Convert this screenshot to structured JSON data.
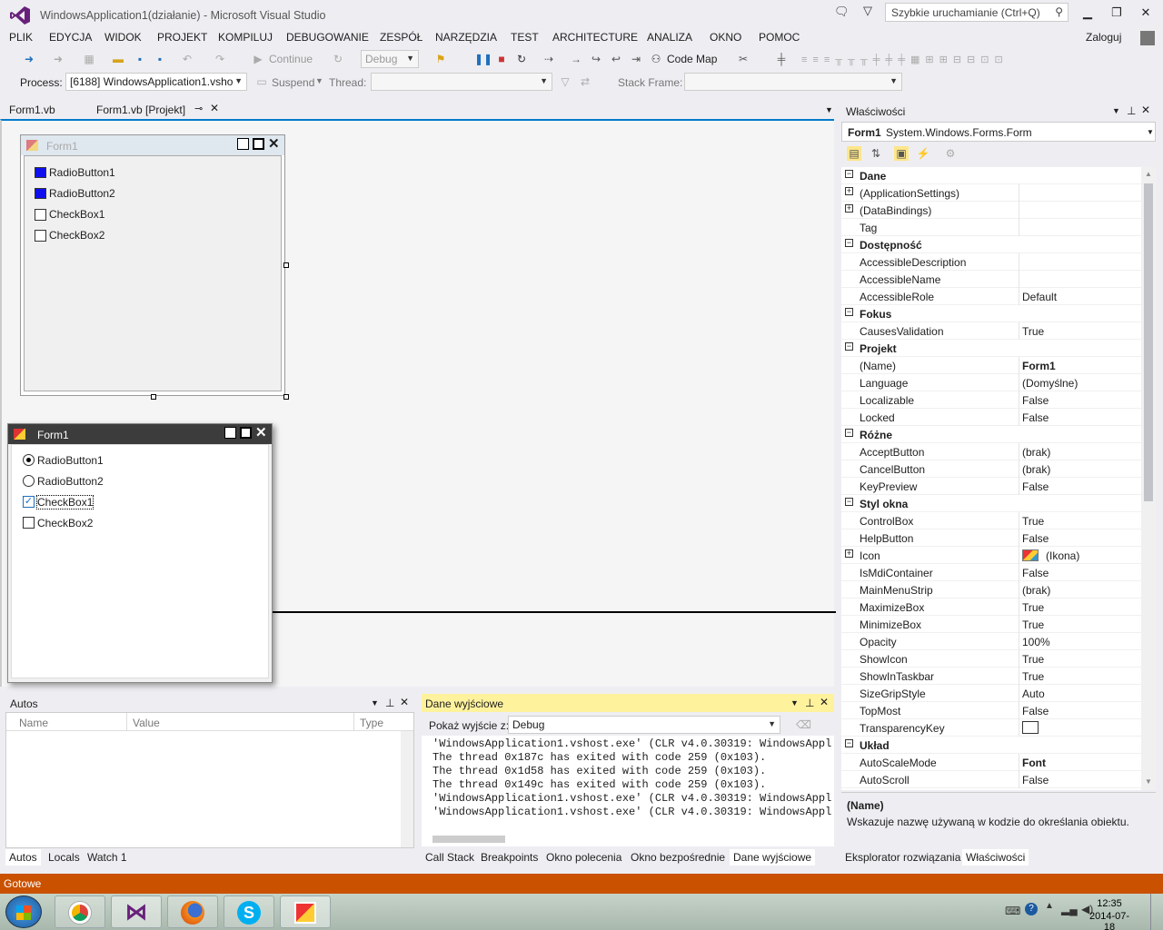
{
  "window": {
    "title": "WindowsApplication1(działanie) - Microsoft Visual Studio",
    "quick_launch": "Szybkie uruchamianie (Ctrl+Q)",
    "signin": "Zaloguj"
  },
  "menu": [
    "PLIK",
    "EDYCJA",
    "WIDOK",
    "PROJEKT",
    "KOMPILUJ",
    "DEBUGOWANIE",
    "ZESPÓŁ",
    "NARZĘDZIA",
    "TEST",
    "ARCHITECTURE",
    "ANALIZA",
    "OKNO",
    "POMOC"
  ],
  "toolbar": {
    "continue": "Continue",
    "config": "Debug",
    "codemap": "Code Map"
  },
  "toolbar2": {
    "process_label": "Process:",
    "process": "[6188] WindowsApplication1.vsho",
    "suspend": "Suspend",
    "thread_label": "Thread:",
    "stack_label": "Stack Frame:"
  },
  "doctabs": [
    "Form1.vb",
    "Form1.vb [Projekt]"
  ],
  "design_form": {
    "title": "Form1",
    "items": [
      "RadioButton1",
      "RadioButton2",
      "CheckBox1",
      "CheckBox2"
    ]
  },
  "run_form": {
    "title": "Form1",
    "items": [
      "RadioButton1",
      "RadioButton2",
      "CheckBox1",
      "CheckBox2"
    ]
  },
  "autos": {
    "title": "Autos",
    "cols": [
      "Name",
      "Value",
      "Type"
    ],
    "tabs": [
      "Autos",
      "Locals",
      "Watch 1"
    ]
  },
  "output": {
    "title": "Dane wyjściowe",
    "show_label": "Pokaż wyjście z:",
    "source": "Debug",
    "lines": [
      "'WindowsApplication1.vshost.exe' (CLR v4.0.30319: WindowsAppl",
      "The thread 0x187c has exited with code 259 (0x103).",
      "The thread 0x1d58 has exited with code 259 (0x103).",
      "The thread 0x149c has exited with code 259 (0x103).",
      "'WindowsApplication1.vshost.exe' (CLR v4.0.30319: WindowsAppl",
      "'WindowsApplication1.vshost.exe' (CLR v4.0.30319: WindowsAppl"
    ],
    "tabs": [
      "Call Stack",
      "Breakpoints",
      "Okno polecenia",
      "Okno bezpośrednie",
      "Dane wyjściowe"
    ]
  },
  "properties": {
    "title": "Właściwości",
    "object": "Form1",
    "type": "System.Windows.Forms.Form",
    "rows": [
      {
        "c": "Dane"
      },
      {
        "n": "(ApplicationSettings)",
        "v": "",
        "e": 1
      },
      {
        "n": "(DataBindings)",
        "v": "",
        "e": 1
      },
      {
        "n": "Tag",
        "v": ""
      },
      {
        "c": "Dostępność"
      },
      {
        "n": "AccessibleDescription",
        "v": ""
      },
      {
        "n": "AccessibleName",
        "v": ""
      },
      {
        "n": "AccessibleRole",
        "v": "Default"
      },
      {
        "c": "Fokus"
      },
      {
        "n": "CausesValidation",
        "v": "True"
      },
      {
        "c": "Projekt"
      },
      {
        "n": "(Name)",
        "v": "Form1",
        "b": 1
      },
      {
        "n": "Language",
        "v": "(Domyślne)"
      },
      {
        "n": "Localizable",
        "v": "False"
      },
      {
        "n": "Locked",
        "v": "False"
      },
      {
        "c": "Różne"
      },
      {
        "n": "AcceptButton",
        "v": "(brak)"
      },
      {
        "n": "CancelButton",
        "v": "(brak)"
      },
      {
        "n": "KeyPreview",
        "v": "False"
      },
      {
        "c": "Styl okna"
      },
      {
        "n": "ControlBox",
        "v": "True"
      },
      {
        "n": "HelpButton",
        "v": "False"
      },
      {
        "n": "Icon",
        "v": "(Ikona)",
        "e": 1,
        "icon": 1
      },
      {
        "n": "IsMdiContainer",
        "v": "False"
      },
      {
        "n": "MainMenuStrip",
        "v": "(brak)"
      },
      {
        "n": "MaximizeBox",
        "v": "True"
      },
      {
        "n": "MinimizeBox",
        "v": "True"
      },
      {
        "n": "Opacity",
        "v": "100%"
      },
      {
        "n": "ShowIcon",
        "v": "True"
      },
      {
        "n": "ShowInTaskbar",
        "v": "True"
      },
      {
        "n": "SizeGripStyle",
        "v": "Auto"
      },
      {
        "n": "TopMost",
        "v": "False"
      },
      {
        "n": "TransparencyKey",
        "v": "",
        "sw": 1
      },
      {
        "c": "Układ"
      },
      {
        "n": "AutoScaleMode",
        "v": "Font",
        "b": 1
      },
      {
        "n": "AutoScroll",
        "v": "False"
      }
    ],
    "desc_title": "(Name)",
    "desc": "Wskazuje nazwę używaną w kodzie do określania obiektu.",
    "tabs": [
      "Eksplorator rozwiązania",
      "Właściwości"
    ]
  },
  "status": "Gotowe",
  "clock": {
    "time": "12:35",
    "date": "2014-07-18"
  }
}
